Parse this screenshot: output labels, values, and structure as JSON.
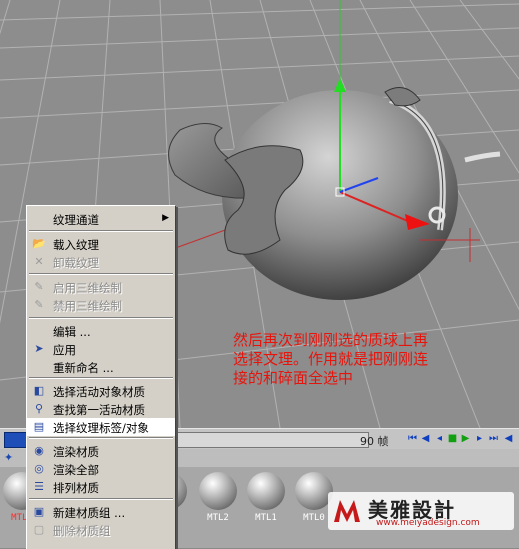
{
  "annotation": {
    "line1": "然后再次到刚刚选的质球上再",
    "line2": "选择文理。作用就是把刚刚连",
    "line3": "接的和碎面全选中"
  },
  "context_menu": {
    "items": [
      {
        "label": "纹理通道",
        "icon": "none",
        "disabled": false,
        "submenu": true
      },
      {
        "label": "载入纹理",
        "icon": "load-texture-icon",
        "disabled": false
      },
      {
        "label": "卸载纹理",
        "icon": "unload-texture-icon",
        "disabled": true
      },
      {
        "label": "启用三维绘制",
        "icon": "enable-3d-paint-icon",
        "disabled": true
      },
      {
        "label": "禁用三维绘制",
        "icon": "disable-3d-paint-icon",
        "disabled": true
      },
      {
        "label": "编辑 ...",
        "icon": "none",
        "disabled": false
      },
      {
        "label": "应用",
        "icon": "apply-icon",
        "disabled": false
      },
      {
        "label": "重新命名 ...",
        "icon": "none",
        "disabled": false
      },
      {
        "label": "选择活动对象材质",
        "icon": "select-active-material-icon",
        "disabled": false
      },
      {
        "label": "查找第一活动材质",
        "icon": "find-material-icon",
        "disabled": false
      },
      {
        "label": "选择纹理标签/对象",
        "icon": "select-texture-tag-icon",
        "disabled": false,
        "highlighted": true
      },
      {
        "label": "渲染材质",
        "icon": "render-material-icon",
        "disabled": false
      },
      {
        "label": "渲染全部",
        "icon": "render-all-icon",
        "disabled": false
      },
      {
        "label": "排列材质",
        "icon": "sort-materials-icon",
        "disabled": false
      },
      {
        "label": "新建材质组 ...",
        "icon": "new-group-icon",
        "disabled": false
      },
      {
        "label": "删除材质组",
        "icon": "delete-group-icon",
        "disabled": true
      }
    ]
  },
  "timeline": {
    "frame_label": "90 帧"
  },
  "materials": [
    {
      "name": "MTL6",
      "selected": true
    },
    {
      "name": "MTL",
      "selected": false
    },
    {
      "name": "MTL",
      "selected": false
    },
    {
      "name": "MTL",
      "selected": false
    },
    {
      "name": "MTL2",
      "selected": false
    },
    {
      "name": "MTL1",
      "selected": false
    },
    {
      "name": "MTL0",
      "selected": false
    }
  ],
  "watermark": {
    "brand": "美雅設計",
    "url": "www.meiyadesign.com"
  },
  "colors": {
    "annotation": "#e8140c",
    "menu_bg": "#d4d0c8",
    "viewport_bg": "#8d8d8d"
  }
}
